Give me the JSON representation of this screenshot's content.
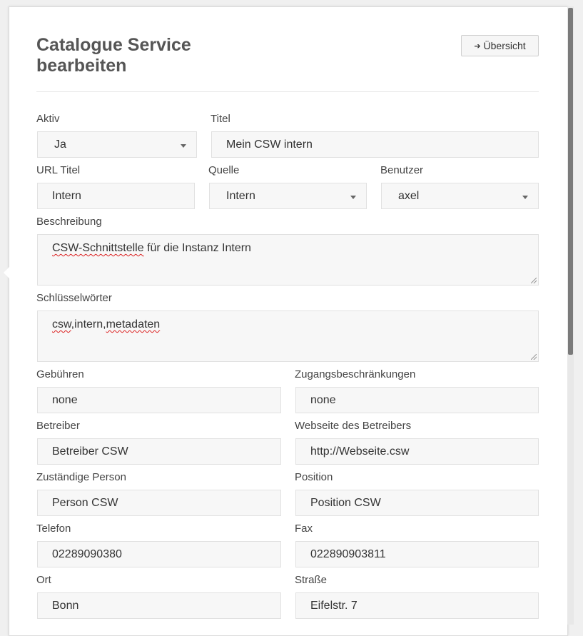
{
  "header": {
    "title": "Catalogue Service bearbeiten",
    "overview_label": "Übersicht",
    "overview_icon": "sign-out-icon"
  },
  "form": {
    "aktiv": {
      "label": "Aktiv",
      "value": "Ja"
    },
    "titel": {
      "label": "Titel",
      "value": "Mein CSW intern"
    },
    "url_titel": {
      "label": "URL Titel",
      "value": "Intern"
    },
    "quelle": {
      "label": "Quelle",
      "value": "Intern"
    },
    "benutzer": {
      "label": "Benutzer",
      "value": "axel"
    },
    "beschreibung": {
      "label": "Beschreibung",
      "value_part1": "CSW-Schnittstelle",
      "value_part2": " für die Instanz Intern"
    },
    "schluesselwoerter": {
      "label": "Schlüsselwörter",
      "value_part1": "csw",
      "value_part2": ",intern,",
      "value_part3": "metadaten"
    },
    "gebuehren": {
      "label": "Gebühren",
      "value": "none"
    },
    "zugang": {
      "label": "Zugangsbeschränkungen",
      "value": "none"
    },
    "betreiber": {
      "label": "Betreiber",
      "value": "Betreiber CSW"
    },
    "webseite": {
      "label": "Webseite des Betreibers",
      "value": "http://Webseite.csw"
    },
    "person": {
      "label": "Zuständige Person",
      "value": "Person CSW"
    },
    "position": {
      "label": "Position",
      "value": "Position CSW"
    },
    "telefon": {
      "label": "Telefon",
      "value": "02289090380"
    },
    "fax": {
      "label": "Fax",
      "value": "022890903811"
    },
    "ort": {
      "label": "Ort",
      "value": "Bonn"
    },
    "strasse": {
      "label": "Straße",
      "value": "Eifelstr. 7"
    }
  }
}
